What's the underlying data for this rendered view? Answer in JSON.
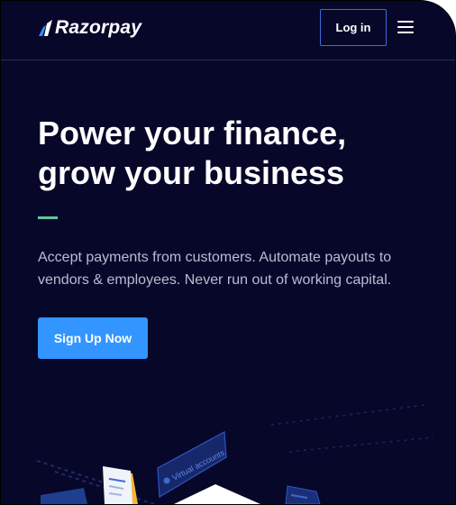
{
  "brand": {
    "name": "Razorpay",
    "logo_icon": "razorpay-logo-icon"
  },
  "header": {
    "login_label": "Log in",
    "menu_icon": "hamburger-menu-icon"
  },
  "hero": {
    "title_line1": "Power your finance,",
    "title_line2": "grow your business",
    "subtitle": "Accept payments from customers. Automate payouts to vendors & employees. Never run out of working capital.",
    "cta_label": "Sign Up Now"
  },
  "illustration": {
    "virtual_accounts_label": "Virtual accounts"
  },
  "colors": {
    "background": "#070729",
    "accent_green": "#5ec6a0",
    "cta_blue": "#3395ff",
    "login_border": "#3d6ad6"
  }
}
